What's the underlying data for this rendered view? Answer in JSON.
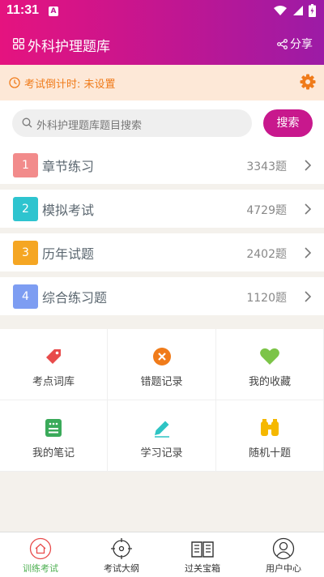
{
  "status_bar": {
    "time": "11:31"
  },
  "header": {
    "title": "外科护理题库",
    "share_label": "分享"
  },
  "countdown": {
    "text": "考试倒计时: 未设置"
  },
  "search": {
    "placeholder": "外科护理题库题目搜索",
    "button_label": "搜索"
  },
  "sections": [
    {
      "index": "1",
      "label": "章节练习",
      "count": "3343题",
      "color": "#f28b8b"
    },
    {
      "index": "2",
      "label": "模拟考试",
      "count": "4729题",
      "color": "#2ec4cf"
    },
    {
      "index": "3",
      "label": "历年试题",
      "count": "2402题",
      "color": "#f5a623"
    },
    {
      "index": "4",
      "label": "综合练习题",
      "count": "1120题",
      "color": "#7d9df2"
    }
  ],
  "tools": [
    {
      "label": "考点词库",
      "icon": "tag-icon",
      "color": "#e84b4b"
    },
    {
      "label": "错题记录",
      "icon": "x-circle-icon",
      "color": "#f07b1a"
    },
    {
      "label": "我的收藏",
      "icon": "heart-icon",
      "color": "#7cc448"
    },
    {
      "label": "我的笔记",
      "icon": "notebook-icon",
      "color": "#3aaa5a"
    },
    {
      "label": "学习记录",
      "icon": "pencil-icon",
      "color": "#2ec4c4"
    },
    {
      "label": "随机十题",
      "icon": "binoculars-icon",
      "color": "#f5b800"
    }
  ],
  "tabs": [
    {
      "label": "训练考试",
      "icon": "home-icon",
      "active": true
    },
    {
      "label": "考试大纲",
      "icon": "compass-icon",
      "active": false
    },
    {
      "label": "过关宝箱",
      "icon": "book-icon",
      "active": false
    },
    {
      "label": "用户中心",
      "icon": "user-icon",
      "active": false
    }
  ],
  "colors": {
    "accent": "#c8188d",
    "warning": "#f07b1a",
    "tab_active": "#4caf50"
  }
}
